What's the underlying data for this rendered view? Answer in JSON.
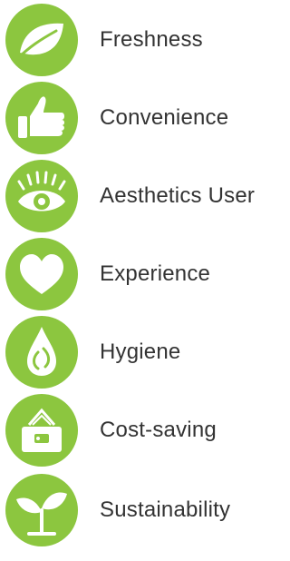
{
  "accent_color": "#8cc63f",
  "text_color": "#333333",
  "items": [
    {
      "label": "Freshness",
      "icon": "leaf-icon"
    },
    {
      "label": "Convenience",
      "icon": "thumbs-up-icon"
    },
    {
      "label": "Aesthetics User",
      "icon": "eye-icon"
    },
    {
      "label": "Experience",
      "icon": "heart-icon"
    },
    {
      "label": "Hygiene",
      "icon": "water-drop-icon"
    },
    {
      "label": "Cost-saving",
      "icon": "wallet-icon"
    },
    {
      "label": "Sustainability",
      "icon": "sprout-icon"
    }
  ]
}
